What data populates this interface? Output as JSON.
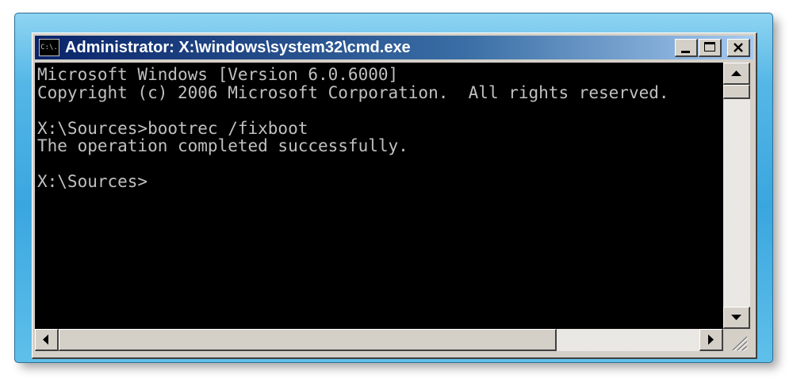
{
  "window": {
    "title": "Administrator: X:\\windows\\system32\\cmd.exe",
    "icon_text": "C:\\."
  },
  "icons": {
    "app": "command-prompt-icon",
    "minimize": "minimize-icon",
    "maximize": "maximize-icon",
    "close": "close-icon",
    "scroll_up": "arrow-up-icon",
    "scroll_down": "arrow-down-icon",
    "scroll_left": "arrow-left-icon",
    "scroll_right": "arrow-right-icon"
  },
  "console": {
    "text": "Microsoft Windows [Version 6.0.6000]\nCopyright (c) 2006 Microsoft Corporation.  All rights reserved.\n\nX:\\Sources>bootrec /fixboot\nThe operation completed successfully.\n\nX:\\Sources>"
  },
  "colors": {
    "console_bg": "#000000",
    "console_fg": "#c0c0c0",
    "titlebar_start": "#0a246a",
    "titlebar_end": "#a6caf0",
    "frame": "#3aa6df"
  }
}
